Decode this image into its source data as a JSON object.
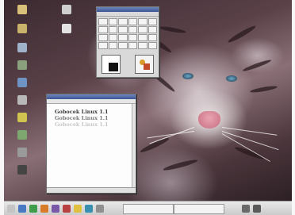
{
  "palette": {
    "title": "",
    "menu": "",
    "tools": [
      "",
      "",
      "",
      "",
      "",
      "",
      "",
      "",
      "",
      "",
      "",
      "",
      "",
      "",
      "",
      "",
      "",
      "",
      "",
      "",
      "",
      "",
      "",
      ""
    ]
  },
  "text_window": {
    "title": "",
    "menu": "",
    "lines": [
      {
        "text": "Gobocek Linux 1.1",
        "color": "#3a3a3a"
      },
      {
        "text": "Gobocek Linux 1.1",
        "color": "#7a7a7a"
      },
      {
        "text": "Gobocek Linux 1.1",
        "color": "#c8c8c8"
      }
    ],
    "status": ""
  },
  "desktop_icons": [
    {
      "name": "",
      "icon": "folder-icon"
    },
    {
      "name": "",
      "icon": "folder-icon"
    },
    {
      "name": "",
      "icon": "computer-icon"
    },
    {
      "name": "",
      "icon": "network-icon"
    },
    {
      "name": "",
      "icon": "globe-icon"
    },
    {
      "name": "",
      "icon": "printer-icon"
    },
    {
      "name": "",
      "icon": "disk-icon"
    },
    {
      "name": "",
      "icon": "trash-icon"
    },
    {
      "name": "",
      "icon": "settings-icon"
    },
    {
      "name": "",
      "icon": "terminal-icon"
    }
  ],
  "top_icons": [
    {
      "name": "",
      "icon": "home-icon"
    },
    {
      "name": "",
      "icon": "document-icon"
    }
  ],
  "taskbar": {
    "clock": "",
    "tasks": [
      "",
      ""
    ]
  }
}
